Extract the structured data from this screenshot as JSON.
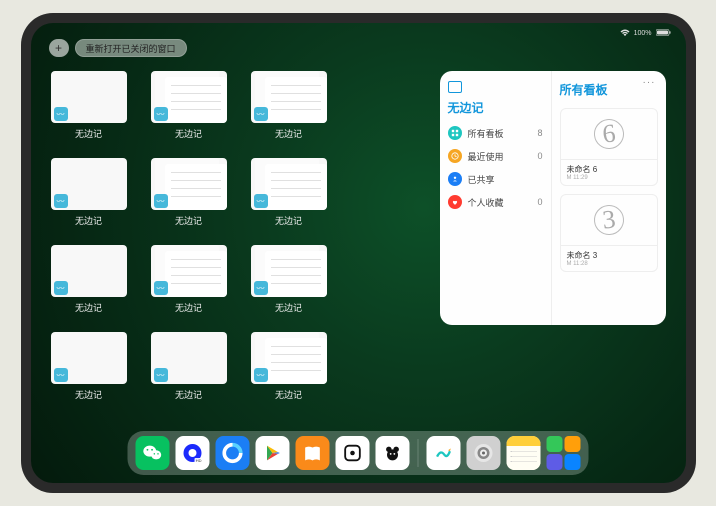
{
  "status": {
    "battery": "100%"
  },
  "toolbar": {
    "plus_label": "+",
    "reopen_label": "重新打开已关闭的窗口"
  },
  "app_thumb_label": "无边记",
  "thumbs": [
    {
      "variant": "a"
    },
    {
      "variant": "b"
    },
    {
      "variant": "b"
    },
    null,
    {
      "variant": "a"
    },
    {
      "variant": "b"
    },
    {
      "variant": "b"
    },
    null,
    {
      "variant": "a"
    },
    {
      "variant": "b"
    },
    {
      "variant": "b"
    },
    null,
    {
      "variant": "a"
    },
    {
      "variant": "a"
    },
    {
      "variant": "b"
    },
    null
  ],
  "panel": {
    "left_title": "无边记",
    "right_title": "所有看板",
    "rows": [
      {
        "icon": "grid",
        "color": "#1ec6c0",
        "label": "所有看板",
        "count": "8"
      },
      {
        "icon": "clock",
        "color": "#f6a623",
        "label": "最近使用",
        "count": "0"
      },
      {
        "icon": "share",
        "color": "#1b7ef5",
        "label": "已共享",
        "count": ""
      },
      {
        "icon": "heart",
        "color": "#ff3b30",
        "label": "个人收藏",
        "count": "0"
      }
    ],
    "boards": [
      {
        "digit": "6",
        "name": "未命名 6",
        "sub": "M 11:29"
      },
      {
        "digit": "3",
        "name": "未命名 3",
        "sub": "M 11:28"
      }
    ]
  },
  "dock": [
    {
      "name": "wechat",
      "bg": "#07c160"
    },
    {
      "name": "quark",
      "bg": "#ffffff"
    },
    {
      "name": "browser",
      "bg": "#1b7ef5"
    },
    {
      "name": "play",
      "bg": "#ffffff"
    },
    {
      "name": "books",
      "bg": "#fa8a1a"
    },
    {
      "name": "dice",
      "bg": "#ffffff"
    },
    {
      "name": "bear",
      "bg": "#ffffff"
    },
    {
      "name": "freeform",
      "bg": "#ffffff"
    },
    {
      "name": "settings",
      "bg": "#d0d0d0"
    },
    {
      "name": "notes",
      "bg": "#fff9d6"
    },
    {
      "name": "library",
      "bg": ""
    }
  ]
}
